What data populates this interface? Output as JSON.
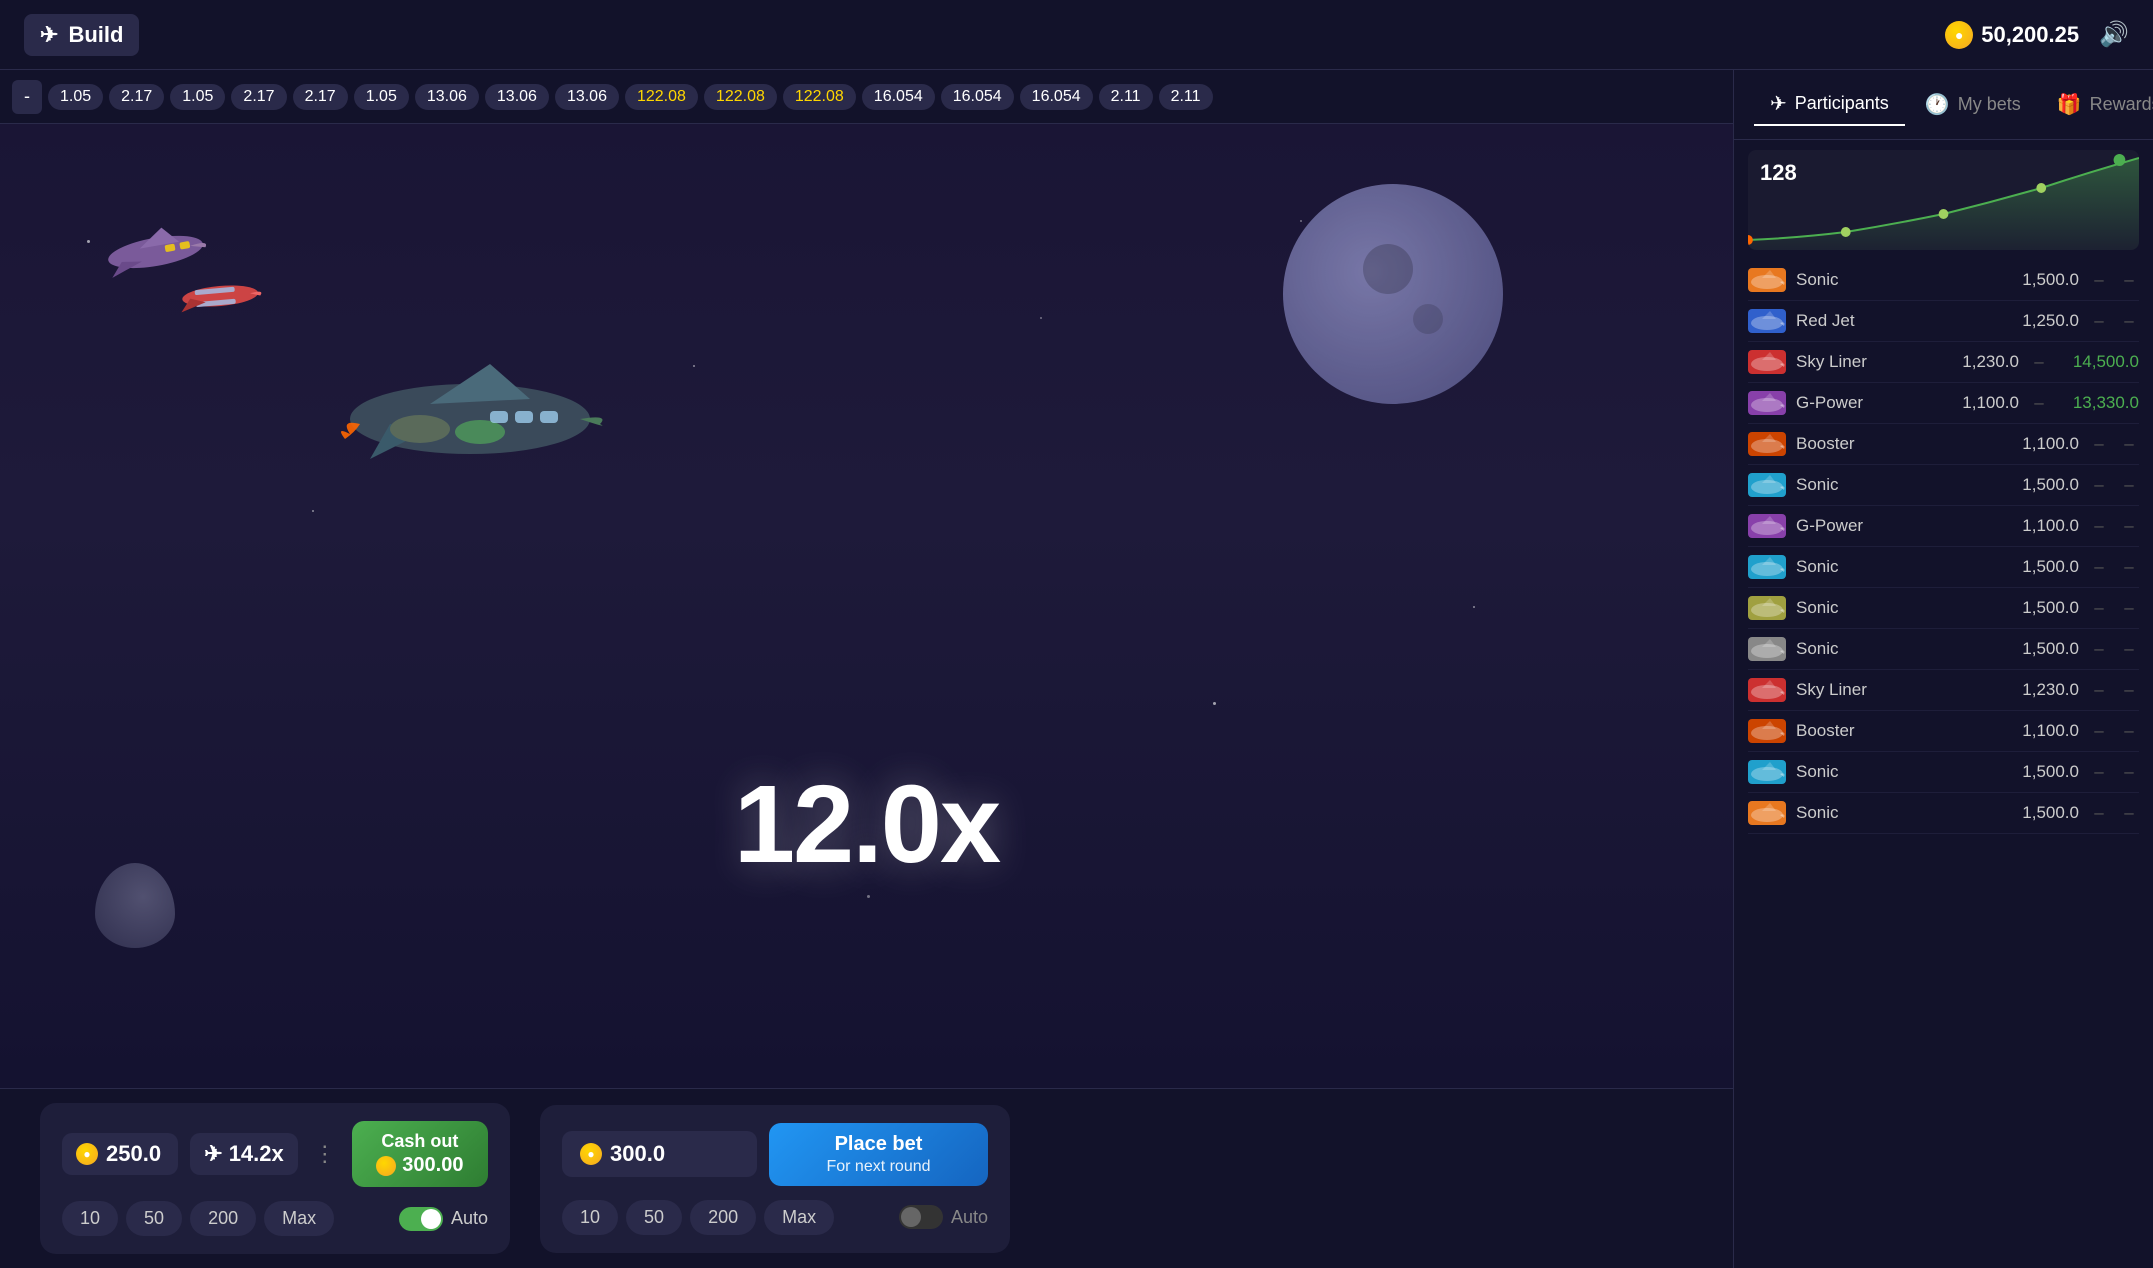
{
  "header": {
    "title": "Build",
    "balance": "50,200.25",
    "volume_label": "volume"
  },
  "multiplier_bar": {
    "minus": "-",
    "values": [
      "1.05",
      "2.17",
      "1.05",
      "2.17",
      "2.17",
      "1.05",
      "13.06",
      "13.06",
      "13.06",
      "122.08",
      "122.08",
      "122.08",
      "16.054",
      "16.054",
      "16.054",
      "2.11",
      "2.11"
    ]
  },
  "game": {
    "multiplier": "12.0x"
  },
  "panel1": {
    "bet_amount": "250.0",
    "multiplier": "14.2x",
    "cashout_label": "Cash out",
    "cashout_amount": "300.00",
    "quick_btns": [
      "10",
      "50",
      "200",
      "Max"
    ],
    "auto_label": "Auto",
    "auto_active": true
  },
  "panel2": {
    "bet_amount": "300.0",
    "place_bet_label": "Place bet",
    "place_bet_sub": "For next round",
    "quick_btns": [
      "10",
      "50",
      "200",
      "Max"
    ],
    "auto_label": "Auto",
    "auto_active": false
  },
  "right_panel": {
    "tabs": [
      {
        "label": "Participants",
        "active": true
      },
      {
        "label": "My bets",
        "active": false
      },
      {
        "label": "Rewards",
        "active": false
      }
    ],
    "graph_count": "128",
    "participants": [
      {
        "name": "Sonic",
        "bet": "1,500.0",
        "dash": "–",
        "cashout": null
      },
      {
        "name": "Red Jet",
        "bet": "1,250.0",
        "dash": "–",
        "cashout": null
      },
      {
        "name": "Sky Liner",
        "bet": "1,230.0",
        "dash": "–",
        "cashout": "14,500.0"
      },
      {
        "name": "G-Power",
        "bet": "1,100.0",
        "dash": "–",
        "cashout": "13,330.0"
      },
      {
        "name": "Booster",
        "bet": "1,100.0",
        "dash": "–",
        "cashout": null
      },
      {
        "name": "Sonic",
        "bet": "1,500.0",
        "dash": "–",
        "cashout": null
      },
      {
        "name": "G-Power",
        "bet": "1,100.0",
        "dash": "–",
        "cashout": null
      },
      {
        "name": "Sonic",
        "bet": "1,500.0",
        "dash": "–",
        "cashout": null
      },
      {
        "name": "Sonic",
        "bet": "1,500.0",
        "dash": "–",
        "cashout": null
      },
      {
        "name": "Sonic",
        "bet": "1,500.0",
        "dash": "–",
        "cashout": null
      },
      {
        "name": "Sky Liner",
        "bet": "1,230.0",
        "dash": "–",
        "cashout": null
      },
      {
        "name": "Booster",
        "bet": "1,100.0",
        "dash": "–",
        "cashout": null
      },
      {
        "name": "Sonic",
        "bet": "1,500.0",
        "dash": "–",
        "cashout": null
      },
      {
        "name": "Sonic",
        "bet": "1,500.0",
        "dash": "–",
        "cashout": null
      }
    ]
  },
  "icons": {
    "plane": "✈",
    "coin": "🪙",
    "volume": "🔊",
    "participants": "✈",
    "my_bets": "🕐",
    "rewards": "🎁",
    "hamburger": "☰"
  },
  "colors": {
    "accent_green": "#4caf50",
    "accent_blue": "#2196f3",
    "accent_gold": "#ffd700",
    "bg_dark": "#12122a",
    "bg_panel": "#1e1e3a",
    "text_primary": "#ffffff",
    "text_secondary": "#cccccc",
    "text_muted": "#888888"
  }
}
